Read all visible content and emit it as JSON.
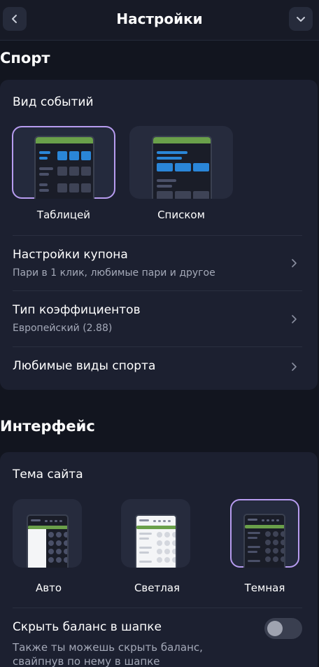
{
  "header": {
    "title": "Настройки",
    "back_icon": "chevron-left-icon",
    "collapse_icon": "chevron-down-icon"
  },
  "sport": {
    "section_title": "Спорт",
    "events_view": {
      "heading": "Вид событий",
      "options": [
        {
          "label": "Таблицей",
          "selected": true
        },
        {
          "label": "Списком",
          "selected": false
        }
      ]
    },
    "rows": [
      {
        "title": "Настройки купона",
        "subtitle": "Пари в 1 клик, любимые пари и другое"
      },
      {
        "title": "Тип коэффициентов",
        "subtitle": "Европейский (2.88)"
      },
      {
        "title": "Любимые виды спорта",
        "subtitle": ""
      }
    ]
  },
  "interface": {
    "section_title": "Интерфейс",
    "theme": {
      "heading": "Тема сайта",
      "options": [
        {
          "label": "Авто",
          "selected": false
        },
        {
          "label": "Светлая",
          "selected": false
        },
        {
          "label": "Темная",
          "selected": true
        }
      ]
    },
    "hide_balance": {
      "title": "Скрыть баланс в шапке",
      "subtitle_line1": "Также ты можешь скрыть баланс,",
      "subtitle_line2": "свайпнув по нему в шапке",
      "enabled": false
    }
  },
  "colors": {
    "accent_selected": "#b79cf0",
    "preview_green": "#6aa04a",
    "preview_blue": "#2a86d8",
    "background": "#12151f",
    "card": "#1c2030"
  }
}
